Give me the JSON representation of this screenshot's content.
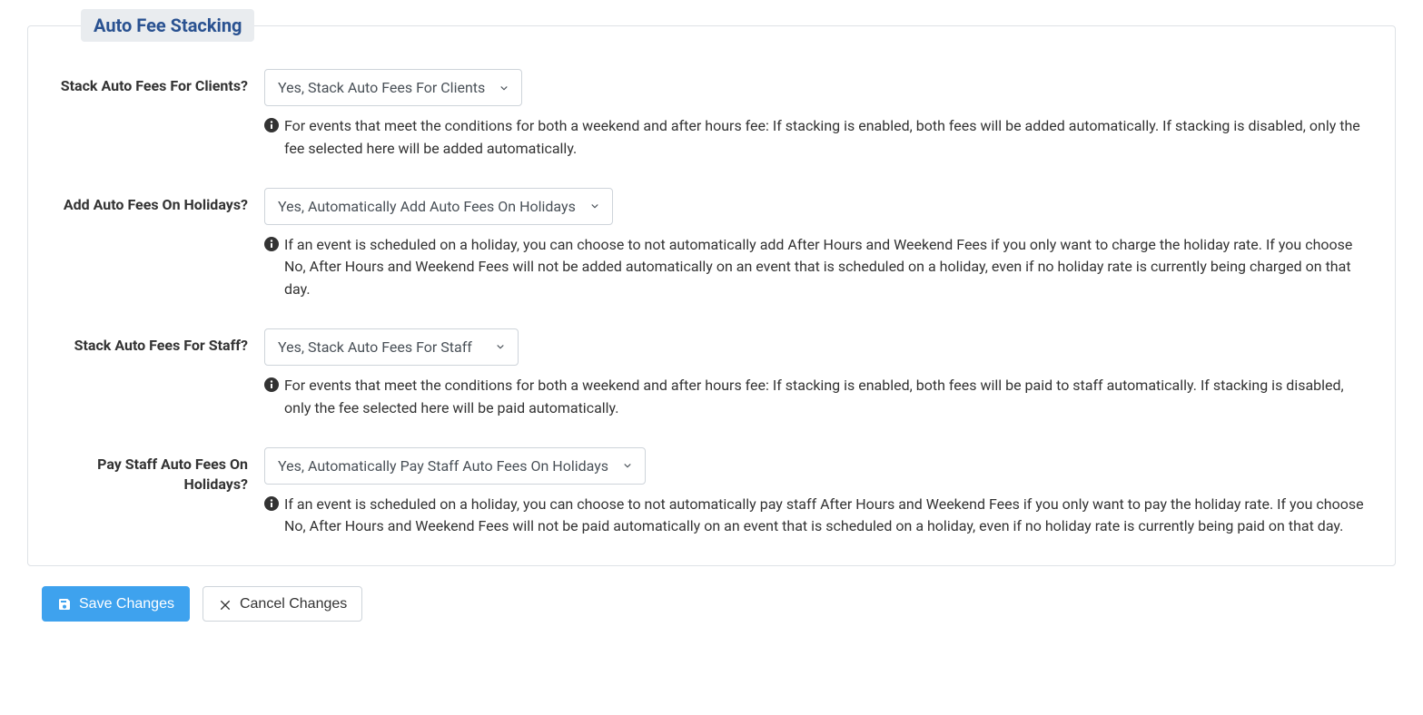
{
  "panel_title": "Auto Fee Stacking",
  "fields": {
    "stack_clients": {
      "label": "Stack Auto Fees For Clients?",
      "value": "Yes, Stack Auto Fees For Clients",
      "help": "For events that meet the conditions for both a weekend and after hours fee: If stacking is enabled, both fees will be added automatically. If stacking is disabled, only the fee selected here will be added automatically."
    },
    "holidays_add": {
      "label": "Add Auto Fees On Holidays?",
      "value": "Yes, Automatically Add Auto Fees On Holidays",
      "help": "If an event is scheduled on a holiday, you can choose to not automatically add After Hours and Weekend Fees if you only want to charge the holiday rate. If you choose No, After Hours and Weekend Fees will not be added automatically on an event that is scheduled on a holiday, even if no holiday rate is currently being charged on that day."
    },
    "stack_staff": {
      "label": "Stack Auto Fees For Staff?",
      "value": "Yes, Stack Auto Fees For Staff",
      "help": "For events that meet the conditions for both a weekend and after hours fee: If stacking is enabled, both fees will be paid to staff automatically. If stacking is disabled, only the fee selected here will be paid automatically."
    },
    "holidays_pay_staff": {
      "label": "Pay Staff Auto Fees On Holidays?",
      "value": "Yes, Automatically Pay Staff Auto Fees On Holidays",
      "help": "If an event is scheduled on a holiday, you can choose to not automatically pay staff After Hours and Weekend Fees if you only want to pay the holiday rate. If you choose No, After Hours and Weekend Fees will not be paid automatically on an event that is scheduled on a holiday, even if no holiday rate is currently being paid on that day."
    }
  },
  "buttons": {
    "save": "Save Changes",
    "cancel": "Cancel Changes"
  }
}
